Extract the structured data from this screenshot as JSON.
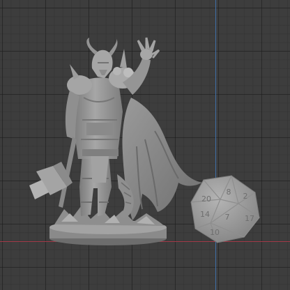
{
  "viewport": {
    "background_color": "#3d3d3d",
    "grid_color": "#2c2c2c",
    "x_axis_color": "#a23a48",
    "y_axis_color": "#3f6fa8",
    "model_color": "#9d9d9d"
  },
  "scene": {
    "objects": [
      {
        "name": "warrior-figurine"
      },
      {
        "name": "d20-die"
      }
    ]
  },
  "die": {
    "faces": [
      "20",
      "8",
      "14",
      "2",
      "17",
      "7",
      "10"
    ]
  }
}
